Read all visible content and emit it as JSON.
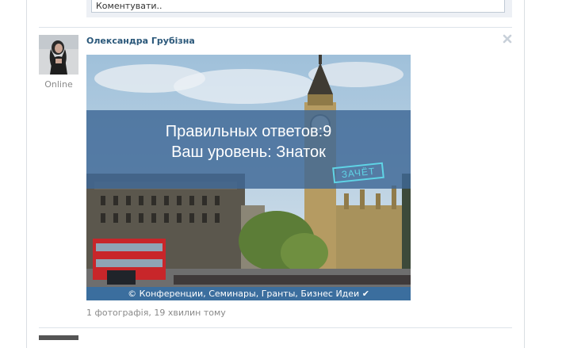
{
  "comment": {
    "placeholder": "Коментувати.."
  },
  "post": {
    "author": "Олександра Грубізна",
    "status": "Online",
    "image": {
      "line1": "Правильных ответов:9",
      "line2": "Ваш уровень: Знаток",
      "stamp": "ЗАЧЁТ",
      "caption": "© Конференции, Семинары, Гранты, Бизнес Идеи ✔"
    },
    "meta": "1 фотографія, 19 хвилин тому"
  },
  "icons": {
    "close": "close-icon"
  },
  "colors": {
    "link": "#2b587a",
    "banner": "#3e6896",
    "caption_bg": "#3b6e9e",
    "stamp": "#5fd4e6"
  }
}
